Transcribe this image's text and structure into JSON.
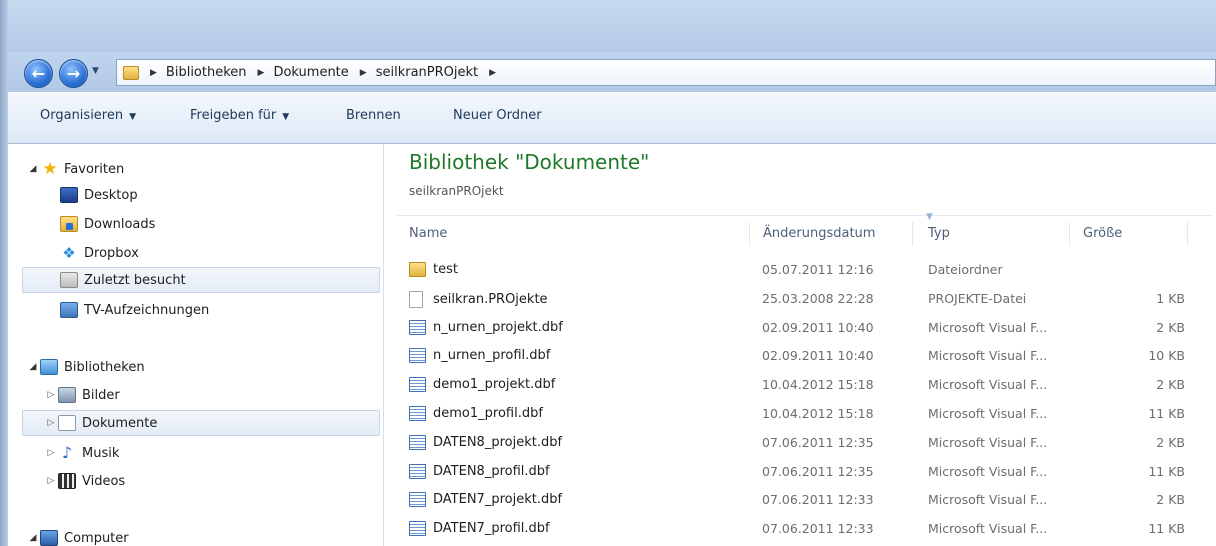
{
  "address": {
    "crumbs": [
      "Bibliotheken",
      "Dokumente",
      "seilkranPROjekt"
    ]
  },
  "toolbar": {
    "organize": "Organisieren",
    "share": "Freigeben für",
    "burn": "Brennen",
    "new_folder": "Neuer Ordner"
  },
  "nav": {
    "favorites": "Favoriten",
    "desktop": "Desktop",
    "downloads": "Downloads",
    "dropbox": "Dropbox",
    "recent": "Zuletzt besucht",
    "tv": "TV-Aufzeichnungen",
    "libraries": "Bibliotheken",
    "pictures": "Bilder",
    "documents": "Dokumente",
    "music": "Musik",
    "videos": "Videos",
    "computer": "Computer"
  },
  "content": {
    "title": "Bibliothek \"Dokumente\"",
    "subtitle": "seilkranPROjekt",
    "columns": {
      "name": "Name",
      "date": "Änderungsdatum",
      "type": "Typ",
      "size": "Größe"
    },
    "files": [
      {
        "name": "test",
        "date": "05.07.2011 12:16",
        "type": "Dateiordner",
        "size": "",
        "icon": "folder"
      },
      {
        "name": "seilkran.PROjekte",
        "date": "25.03.2008 22:28",
        "type": "PROJEKTE-Datei",
        "size": "1 KB",
        "icon": "file"
      },
      {
        "name": "n_urnen_projekt.dbf",
        "date": "02.09.2011 10:40",
        "type": "Microsoft Visual F...",
        "size": "2 KB",
        "icon": "dbf"
      },
      {
        "name": "n_urnen_profil.dbf",
        "date": "02.09.2011 10:40",
        "type": "Microsoft Visual F...",
        "size": "10 KB",
        "icon": "dbf"
      },
      {
        "name": "demo1_projekt.dbf",
        "date": "10.04.2012 15:18",
        "type": "Microsoft Visual F...",
        "size": "2 KB",
        "icon": "dbf"
      },
      {
        "name": "demo1_profil.dbf",
        "date": "10.04.2012 15:18",
        "type": "Microsoft Visual F...",
        "size": "11 KB",
        "icon": "dbf"
      },
      {
        "name": "DATEN8_projekt.dbf",
        "date": "07.06.2011 12:35",
        "type": "Microsoft Visual F...",
        "size": "2 KB",
        "icon": "dbf"
      },
      {
        "name": "DATEN8_profil.dbf",
        "date": "07.06.2011 12:35",
        "type": "Microsoft Visual F...",
        "size": "11 KB",
        "icon": "dbf"
      },
      {
        "name": "DATEN7_projekt.dbf",
        "date": "07.06.2011 12:33",
        "type": "Microsoft Visual F...",
        "size": "2 KB",
        "icon": "dbf"
      },
      {
        "name": "DATEN7_profil.dbf",
        "date": "07.06.2011 12:33",
        "type": "Microsoft Visual F...",
        "size": "11 KB",
        "icon": "dbf"
      }
    ]
  }
}
